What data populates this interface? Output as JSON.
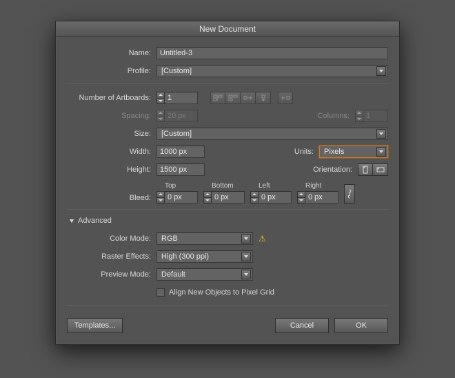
{
  "title": "New Document",
  "fields": {
    "name_label": "Name:",
    "name_value": "Untitled-3",
    "profile_label": "Profile:",
    "profile_value": "[Custom]",
    "artboards_label": "Number of Artboards:",
    "artboards_value": "1",
    "spacing_label": "Spacing:",
    "spacing_value": "20 px",
    "columns_label": "Columns:",
    "columns_value": "1",
    "size_label": "Size:",
    "size_value": "[Custom]",
    "width_label": "Width:",
    "width_value": "1000 px",
    "height_label": "Height:",
    "height_value": "1500 px",
    "units_label": "Units:",
    "units_value": "Pixels",
    "orientation_label": "Orientation:",
    "bleed_label": "Bleed:"
  },
  "bleed": {
    "top_label": "Top",
    "top_value": "0 px",
    "bottom_label": "Bottom",
    "bottom_value": "0 px",
    "left_label": "Left",
    "left_value": "0 px",
    "right_label": "Right",
    "right_value": "0 px"
  },
  "advanced": {
    "header": "Advanced",
    "color_mode_label": "Color Mode:",
    "color_mode_value": "RGB",
    "raster_label": "Raster Effects:",
    "raster_value": "High (300 ppi)",
    "preview_label": "Preview Mode:",
    "preview_value": "Default",
    "align_label": "Align New Objects to Pixel Grid"
  },
  "buttons": {
    "templates": "Templates...",
    "cancel": "Cancel",
    "ok": "OK"
  },
  "icons": {
    "grid1": "grid-by-row-icon",
    "grid2": "grid-by-column-icon",
    "grid3": "arrange-right-icon",
    "grid4": "arrange-down-icon",
    "grid5": "arrange-left-icon",
    "orient_p": "portrait-icon",
    "orient_l": "landscape-icon",
    "link": "link-icon",
    "warn": "warning-icon"
  }
}
